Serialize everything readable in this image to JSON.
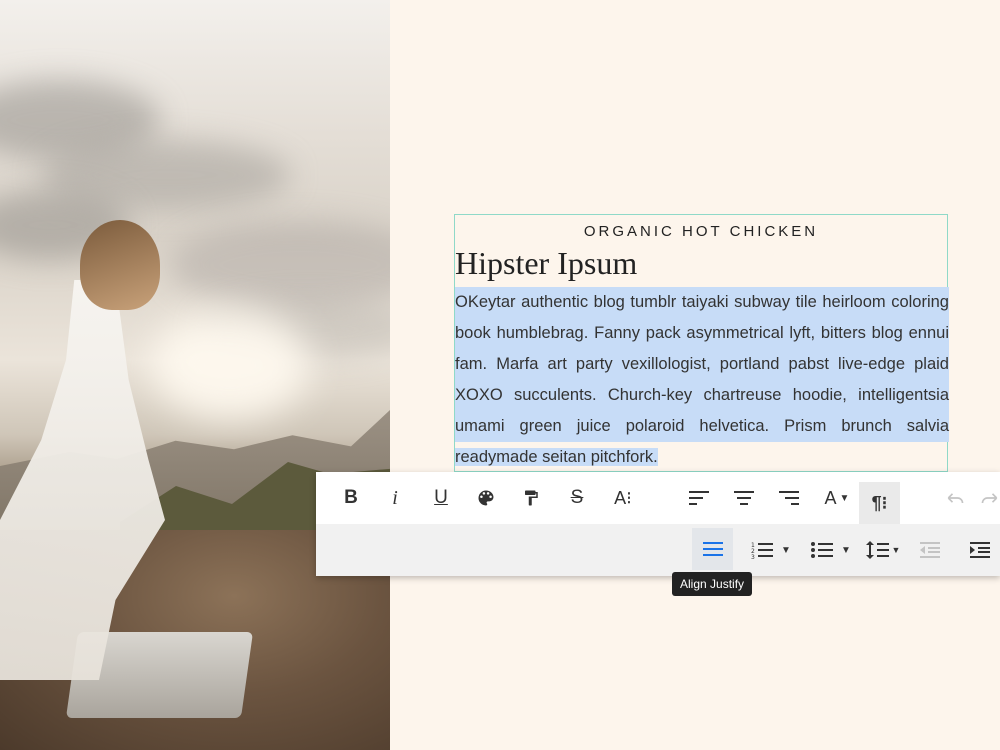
{
  "article": {
    "eyebrow": "ORGANIC HOT CHICKEN",
    "title": "Hipster Ipsum",
    "lines": [
      "OKeytar authentic blog tumblr taiyaki subway tile heirloom coloring",
      "book humblebrag. Fanny pack asymmetrical lyft, bitters blog ennui",
      "fam. Marfa art party vexillologist, portland pabst live-edge plaid",
      "XOXO succulents. Church-key chartreuse hoodie, intelligentsia",
      "umami green juice polaroid helvetica. Prism brunch salvia",
      "readymade seitan pitchfork."
    ]
  },
  "toolbar": {
    "row1": [
      "bold",
      "italic",
      "underline",
      "text-color",
      "format-painter",
      "strikethrough",
      "font-size",
      "align-left",
      "align-center",
      "align-right",
      "text-style",
      "paragraph",
      "undo",
      "redo"
    ],
    "row2": [
      "align-justify",
      "ordered-list",
      "unordered-list",
      "line-height",
      "outdent",
      "indent"
    ],
    "bold_label": "B",
    "italic_label": "i",
    "underline_label": "U",
    "strike_label": "S",
    "fontsize_label": "A⁝",
    "textstyle_label": "A",
    "paragraph_label": "¶⁝",
    "tooltip": "Align Justify"
  },
  "colors": {
    "page_background": "#fdf5ec",
    "selection": "#c7dcf7",
    "active_icon": "#1a73e8",
    "block_outline": "#8fd9c8"
  }
}
